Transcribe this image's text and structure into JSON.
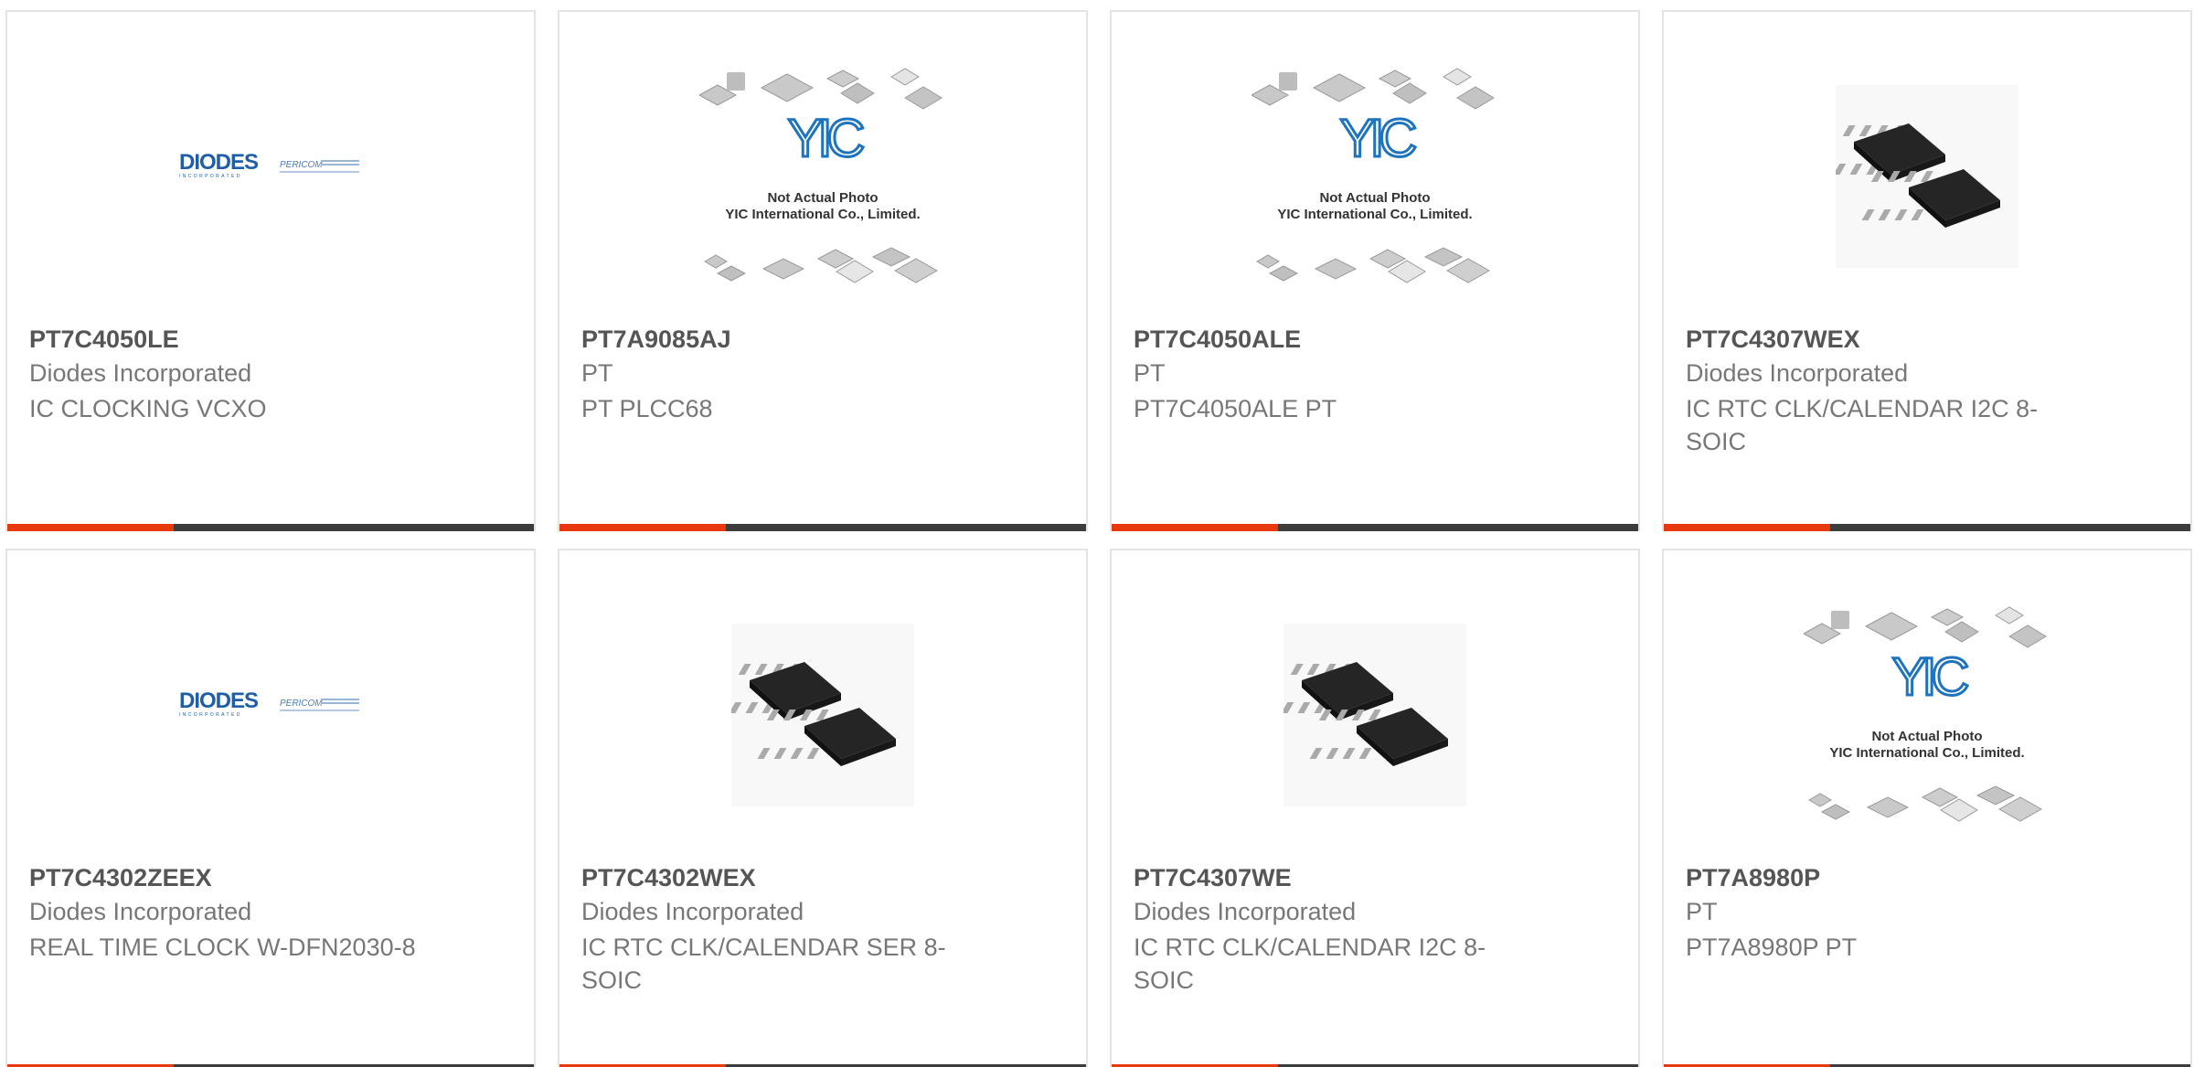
{
  "products": [
    {
      "part_number": "PT7C4050LE",
      "manufacturer": "Diodes Incorporated",
      "description": "IC CLOCKING VCXO",
      "image": "diodes-pericom-logo"
    },
    {
      "part_number": "PT7A9085AJ",
      "manufacturer": "PT",
      "description": "PT PLCC68",
      "image": "yic-not-actual-photo"
    },
    {
      "part_number": "PT7C4050ALE",
      "manufacturer": "PT",
      "description": "PT7C4050ALE PT",
      "image": "yic-not-actual-photo"
    },
    {
      "part_number": "PT7C4307WEX",
      "manufacturer": "Diodes Incorporated",
      "description": "IC RTC CLK/CALENDAR I2C 8-SOIC",
      "image": "soic-8-chips"
    },
    {
      "part_number": "PT7C4302ZEEX",
      "manufacturer": "Diodes Incorporated",
      "description": "REAL TIME CLOCK W-DFN2030-8",
      "image": "diodes-pericom-logo"
    },
    {
      "part_number": "PT7C4302WEX",
      "manufacturer": "Diodes Incorporated",
      "description": "IC RTC CLK/CALENDAR SER 8-SOIC",
      "image": "soic-8-chips"
    },
    {
      "part_number": "PT7C4307WE",
      "manufacturer": "Diodes Incorporated",
      "description": "IC RTC CLK/CALENDAR I2C 8-SOIC",
      "image": "soic-8-chips"
    },
    {
      "part_number": "PT7A8980P",
      "manufacturer": "PT",
      "description": "PT7A8980P PT",
      "image": "yic-not-actual-photo"
    }
  ],
  "placeholder": {
    "line1": "Not Actual Photo",
    "line2": "YIC International Co., Limited.",
    "logo_text": "YIC"
  },
  "brand_logo": {
    "main": "DIODES",
    "sub": "INCORPORATED",
    "secondary": "PERICOM"
  },
  "colors": {
    "accent": "#e8380d",
    "bar": "#3c3c3c",
    "diodes_blue": "#1f5fa8"
  }
}
